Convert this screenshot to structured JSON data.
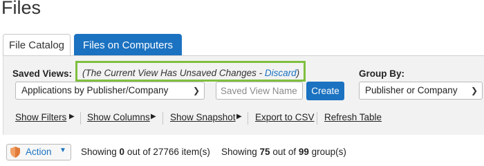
{
  "page": {
    "title": "Files"
  },
  "tabs": [
    {
      "label": "File Catalog",
      "active": false
    },
    {
      "label": "Files on Computers",
      "active": true
    }
  ],
  "saved_views": {
    "label": "Saved Views:",
    "unsaved_notice_prefix": "(The Current View Has Unsaved Changes - ",
    "discard_label": "Discard",
    "unsaved_notice_suffix": ")",
    "selected_view": "Applications by Publisher/Company",
    "name_placeholder": "Saved View Name",
    "create_label": "Create"
  },
  "group_by": {
    "label": "Group By:",
    "selected": "Publisher or Company"
  },
  "links": {
    "show_filters": "Show Filters",
    "show_columns": "Show Columns",
    "show_snapshot": "Show Snapshot",
    "export_csv": "Export to CSV",
    "refresh_table": "Refresh Table"
  },
  "footer": {
    "action_label": "Action",
    "items_prefix": "Showing ",
    "items_shown": "0",
    "items_mid": " out of ",
    "items_total": "27766",
    "items_suffix": " item(s)",
    "groups_prefix": "Showing ",
    "groups_shown": "75",
    "groups_mid": " out of ",
    "groups_total": "99",
    "groups_suffix": " group(s)"
  },
  "colors": {
    "accent": "#1b72c1",
    "highlight_border": "#7fbf3f",
    "panel_bg": "#f2f2f2",
    "shield": "#f0a064"
  },
  "icons": {
    "action": "shield-icon",
    "dropdown": "chevron-down-icon",
    "link_arrow": "caret-right-icon"
  }
}
